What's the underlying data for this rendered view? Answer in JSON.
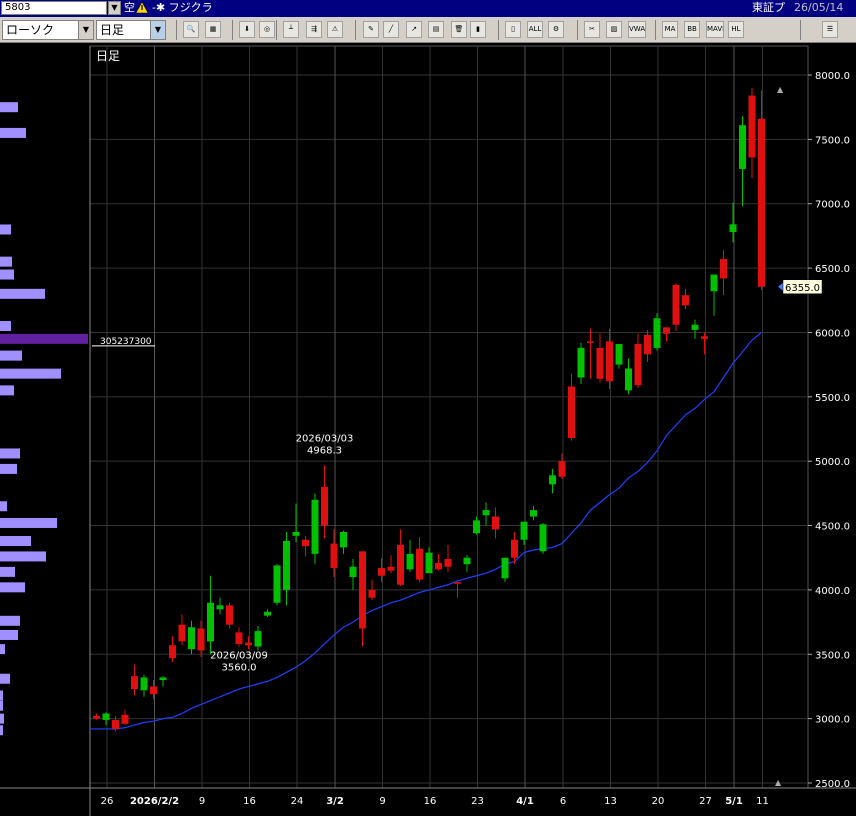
{
  "header": {
    "stock_code": "5803",
    "margin_label": "空",
    "name_prefix": "-✱",
    "stock_name": "フジクラ",
    "exchange": "東証プ",
    "date": "26/05/14"
  },
  "toolbar": {
    "chart_type": "ローソク",
    "period": "日足",
    "buttons": [
      {
        "icon": "zoom-icon",
        "label": "🔍"
      },
      {
        "icon": "table-icon",
        "label": "▦"
      },
      {
        "icon": "cursor-icon",
        "label": "⬇"
      },
      {
        "icon": "search-icon",
        "label": "◎"
      },
      {
        "icon": "bars-icon",
        "label": "┴"
      },
      {
        "icon": "compare-icon",
        "label": "⇶"
      },
      {
        "icon": "alert-icon",
        "label": "⚠"
      },
      {
        "icon": "pen-icon",
        "label": "✎"
      },
      {
        "icon": "line-tool-icon",
        "label": "╱"
      },
      {
        "icon": "arrow-tool-icon",
        "label": "↗"
      },
      {
        "icon": "note-icon",
        "label": "▤"
      },
      {
        "icon": "trash-icon",
        "label": "🗑"
      },
      {
        "icon": "candle-icon",
        "label": "▮"
      },
      {
        "icon": "candle-alt-icon",
        "label": "▯"
      },
      {
        "icon": "all-icon",
        "label": "ALL"
      },
      {
        "icon": "settings-icon",
        "label": "⚙"
      },
      {
        "icon": "wrench-icon",
        "label": "✂"
      },
      {
        "icon": "palette-icon",
        "label": "▨"
      },
      {
        "icon": "vwap-icon",
        "label": "VWAP"
      },
      {
        "icon": "ma-icon",
        "label": "MA"
      },
      {
        "icon": "bb-icon",
        "label": "BB"
      },
      {
        "icon": "mave-icon",
        "label": "MAVE"
      },
      {
        "icon": "hl-icon",
        "label": "HL"
      },
      {
        "icon": "layout-icon",
        "label": "☰"
      }
    ]
  },
  "chart_data": {
    "type": "candlestick",
    "title": "日足",
    "ylim": [
      2500,
      8000
    ],
    "y_ticks": [
      "8000.0",
      "7500.0",
      "7000.0",
      "6500.0",
      "6000.0",
      "5500.0",
      "5000.0",
      "4500.0",
      "4000.0",
      "3500.0",
      "3000.0",
      "2500.0"
    ],
    "x_labels": [
      "26",
      "2026/2/2",
      "9",
      "16",
      "24",
      "3/2",
      "9",
      "16",
      "23",
      "4/1",
      "6",
      "13",
      "20",
      "27",
      "5/1",
      "11"
    ],
    "x_labels_bold": [
      "2026/2/2",
      "3/2",
      "4/1",
      "5/1"
    ],
    "last_price_label": "6355.0",
    "annotations": [
      {
        "date": "2026/03/03",
        "value": "4968.3",
        "kind": "high"
      },
      {
        "date": "2026/03/09",
        "value": "3560.0",
        "kind": "low"
      }
    ],
    "volume_profile_peak_label": "305237300",
    "candles": [
      {
        "o": 3020,
        "h": 3040,
        "l": 2990,
        "c": 3000
      },
      {
        "o": 2990,
        "h": 3050,
        "l": 2950,
        "c": 3040
      },
      {
        "o": 2990,
        "h": 3020,
        "l": 2900,
        "c": 2920
      },
      {
        "o": 3030,
        "h": 3070,
        "l": 2950,
        "c": 2960
      },
      {
        "o": 3330,
        "h": 3420,
        "l": 3180,
        "c": 3230
      },
      {
        "o": 3220,
        "h": 3340,
        "l": 3170,
        "c": 3320
      },
      {
        "o": 3250,
        "h": 3300,
        "l": 3150,
        "c": 3190
      },
      {
        "o": 3300,
        "h": 3330,
        "l": 3250,
        "c": 3320
      },
      {
        "o": 3570,
        "h": 3640,
        "l": 3440,
        "c": 3470
      },
      {
        "o": 3730,
        "h": 3810,
        "l": 3570,
        "c": 3600
      },
      {
        "o": 3540,
        "h": 3760,
        "l": 3500,
        "c": 3710
      },
      {
        "o": 3700,
        "h": 3760,
        "l": 3480,
        "c": 3530
      },
      {
        "o": 3600,
        "h": 4110,
        "l": 3500,
        "c": 3900
      },
      {
        "o": 3850,
        "h": 3940,
        "l": 3810,
        "c": 3880
      },
      {
        "o": 3880,
        "h": 3900,
        "l": 3700,
        "c": 3730
      },
      {
        "o": 3670,
        "h": 3710,
        "l": 3560,
        "c": 3580
      },
      {
        "o": 3590,
        "h": 3640,
        "l": 3540,
        "c": 3570
      },
      {
        "o": 3560,
        "h": 3720,
        "l": 3530,
        "c": 3680
      },
      {
        "o": 3800,
        "h": 3850,
        "l": 3790,
        "c": 3830
      },
      {
        "o": 3900,
        "h": 4200,
        "l": 3880,
        "c": 4190
      },
      {
        "o": 4000,
        "h": 4450,
        "l": 3880,
        "c": 4380
      },
      {
        "o": 4420,
        "h": 4670,
        "l": 4370,
        "c": 4450
      },
      {
        "o": 4390,
        "h": 4420,
        "l": 4260,
        "c": 4340
      },
      {
        "o": 4280,
        "h": 4750,
        "l": 4200,
        "c": 4700
      },
      {
        "o": 4800,
        "h": 4968.3,
        "l": 4400,
        "c": 4500
      },
      {
        "o": 4360,
        "h": 4470,
        "l": 4100,
        "c": 4170
      },
      {
        "o": 4330,
        "h": 4460,
        "l": 4280,
        "c": 4450
      },
      {
        "o": 4100,
        "h": 4240,
        "l": 4000,
        "c": 4180
      },
      {
        "o": 4300,
        "h": 4290,
        "l": 3560,
        "c": 3700
      },
      {
        "o": 4000,
        "h": 4080,
        "l": 3920,
        "c": 3940
      },
      {
        "o": 4170,
        "h": 4250,
        "l": 4060,
        "c": 4110
      },
      {
        "o": 4180,
        "h": 4270,
        "l": 4130,
        "c": 4150
      },
      {
        "o": 4350,
        "h": 4470,
        "l": 4030,
        "c": 4040
      },
      {
        "o": 4160,
        "h": 4390,
        "l": 4140,
        "c": 4280
      },
      {
        "o": 4320,
        "h": 4410,
        "l": 4060,
        "c": 4080
      },
      {
        "o": 4130,
        "h": 4330,
        "l": 4130,
        "c": 4290
      },
      {
        "o": 4210,
        "h": 4280,
        "l": 4150,
        "c": 4160
      },
      {
        "o": 4240,
        "h": 4350,
        "l": 4140,
        "c": 4180
      },
      {
        "o": 4060,
        "h": 4060,
        "l": 3940,
        "c": 4050
      },
      {
        "o": 4200,
        "h": 4270,
        "l": 4140,
        "c": 4250
      },
      {
        "o": 4440,
        "h": 4570,
        "l": 4430,
        "c": 4540
      },
      {
        "o": 4580,
        "h": 4680,
        "l": 4500,
        "c": 4620
      },
      {
        "o": 4570,
        "h": 4640,
        "l": 4400,
        "c": 4470
      },
      {
        "o": 4090,
        "h": 4250,
        "l": 4060,
        "c": 4250
      },
      {
        "o": 4390,
        "h": 4450,
        "l": 4200,
        "c": 4250
      },
      {
        "o": 4390,
        "h": 4510,
        "l": 4350,
        "c": 4530
      },
      {
        "o": 4570,
        "h": 4650,
        "l": 4540,
        "c": 4620
      },
      {
        "o": 4300,
        "h": 4520,
        "l": 4280,
        "c": 4510
      },
      {
        "o": 4820,
        "h": 4940,
        "l": 4750,
        "c": 4890
      },
      {
        "o": 5000,
        "h": 5060,
        "l": 4860,
        "c": 4880
      },
      {
        "o": 5580,
        "h": 5680,
        "l": 5160,
        "c": 5180
      },
      {
        "o": 5650,
        "h": 5920,
        "l": 5600,
        "c": 5880
      },
      {
        "o": 5930,
        "h": 6030,
        "l": 5640,
        "c": 5920
      },
      {
        "o": 5880,
        "h": 5990,
        "l": 5610,
        "c": 5640
      },
      {
        "o": 5930,
        "h": 6030,
        "l": 5560,
        "c": 5620
      },
      {
        "o": 5750,
        "h": 5900,
        "l": 5720,
        "c": 5910
      },
      {
        "o": 5550,
        "h": 5800,
        "l": 5520,
        "c": 5720
      },
      {
        "o": 5910,
        "h": 5990,
        "l": 5570,
        "c": 5590
      },
      {
        "o": 5980,
        "h": 6020,
        "l": 5770,
        "c": 5830
      },
      {
        "o": 5880,
        "h": 6150,
        "l": 5860,
        "c": 6110
      },
      {
        "o": 6040,
        "h": 6030,
        "l": 5930,
        "c": 5990
      },
      {
        "o": 6370,
        "h": 6380,
        "l": 6010,
        "c": 6060
      },
      {
        "o": 6290,
        "h": 6340,
        "l": 6180,
        "c": 6210
      },
      {
        "o": 6020,
        "h": 6100,
        "l": 5950,
        "c": 6060
      },
      {
        "o": 5970,
        "h": 6000,
        "l": 5830,
        "c": 5950
      },
      {
        "o": 6320,
        "h": 6410,
        "l": 6130,
        "c": 6450
      },
      {
        "o": 6570,
        "h": 6640,
        "l": 6290,
        "c": 6420
      },
      {
        "o": 6780,
        "h": 7010,
        "l": 6700,
        "c": 6840
      },
      {
        "o": 7270,
        "h": 7680,
        "l": 6980,
        "c": 7610
      },
      {
        "o": 7840,
        "h": 7900,
        "l": 7200,
        "c": 7360
      },
      {
        "o": 7660,
        "h": 7880,
        "l": 6330,
        "c": 6355
      }
    ],
    "ma": [
      2920,
      2920,
      2930,
      2950,
      2970,
      2980,
      3000,
      3010,
      3040,
      3080,
      3110,
      3140,
      3170,
      3200,
      3230,
      3250,
      3270,
      3290,
      3320,
      3360,
      3400,
      3450,
      3510,
      3580,
      3650,
      3710,
      3750,
      3800,
      3840,
      3870,
      3900,
      3920,
      3950,
      3980,
      4000,
      4020,
      4040,
      4070,
      4090,
      4110,
      4130,
      4160,
      4200,
      4220,
      4290,
      4310,
      4320,
      4330,
      4360,
      4440,
      4520,
      4620,
      4680,
      4740,
      4790,
      4870,
      4920,
      4990,
      5080,
      5200,
      5280,
      5360,
      5410,
      5480,
      5540,
      5650,
      5760,
      5850,
      5940,
      6000
    ],
    "volume_profile": [
      {
        "price": 7750,
        "width": 18
      },
      {
        "price": 7550,
        "width": 26
      },
      {
        "price": 6800,
        "width": 11
      },
      {
        "price": 6550,
        "width": 12
      },
      {
        "price": 6450,
        "width": 14
      },
      {
        "price": 6300,
        "width": 45
      },
      {
        "price": 6050,
        "width": 11
      },
      {
        "price": 5950,
        "width": 88
      },
      {
        "price": 5820,
        "width": 22
      },
      {
        "price": 5680,
        "width": 61
      },
      {
        "price": 5550,
        "width": 14
      },
      {
        "price": 5060,
        "width": 20
      },
      {
        "price": 4940,
        "width": 17
      },
      {
        "price": 4650,
        "width": 7
      },
      {
        "price": 4520,
        "width": 57
      },
      {
        "price": 4380,
        "width": 31
      },
      {
        "price": 4260,
        "width": 46
      },
      {
        "price": 4140,
        "width": 15
      },
      {
        "price": 4020,
        "width": 25
      },
      {
        "price": 3760,
        "width": 20
      },
      {
        "price": 3650,
        "width": 18
      },
      {
        "price": 3540,
        "width": 5
      },
      {
        "price": 3310,
        "width": 10
      },
      {
        "price": 3180,
        "width": 3
      },
      {
        "price": 3100,
        "width": 3
      },
      {
        "price": 3000,
        "width": 4
      },
      {
        "price": 2910,
        "width": 3
      }
    ],
    "colors": {
      "up": "#00c000",
      "down": "#e01010",
      "ma": "#2040ff",
      "volume_profile": "#a090ff",
      "volume_peak": "#6020a0",
      "grid": "#333333",
      "axis_text": "#ffffff"
    }
  }
}
